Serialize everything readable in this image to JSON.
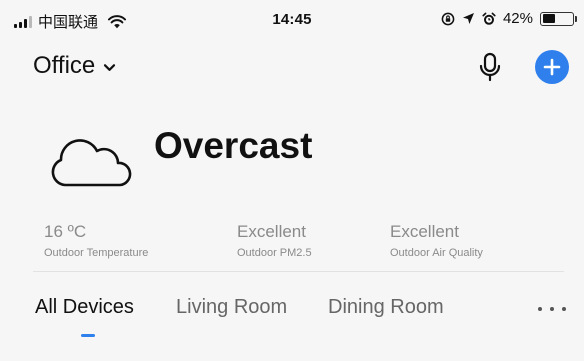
{
  "status_bar": {
    "carrier": "中国联通",
    "time": "14:45",
    "battery_percent": "42%",
    "battery_level": 0.42,
    "icons": [
      "signal-icon",
      "wifi-icon",
      "orientation-lock-icon",
      "location-icon",
      "alarm-icon",
      "battery-icon"
    ]
  },
  "header": {
    "title": "Office",
    "icons": [
      "chevron-down-icon",
      "microphone-icon",
      "plus-icon"
    ]
  },
  "weather": {
    "condition": "Overcast",
    "icon": "cloud-icon"
  },
  "stats": [
    {
      "value": "16 ºC",
      "label": "Outdoor Temperature"
    },
    {
      "value": "Excellent",
      "label": "Outdoor PM2.5"
    },
    {
      "value": "Excellent",
      "label": "Outdoor Air Quality"
    }
  ],
  "tabs": [
    {
      "label": "All Devices",
      "active": true
    },
    {
      "label": "Living Room",
      "active": false
    },
    {
      "label": "Dining Room",
      "active": false
    }
  ],
  "colors": {
    "accent": "#2f80ed",
    "background": "#f6f6f6",
    "muted_text": "#8a8a8a"
  }
}
